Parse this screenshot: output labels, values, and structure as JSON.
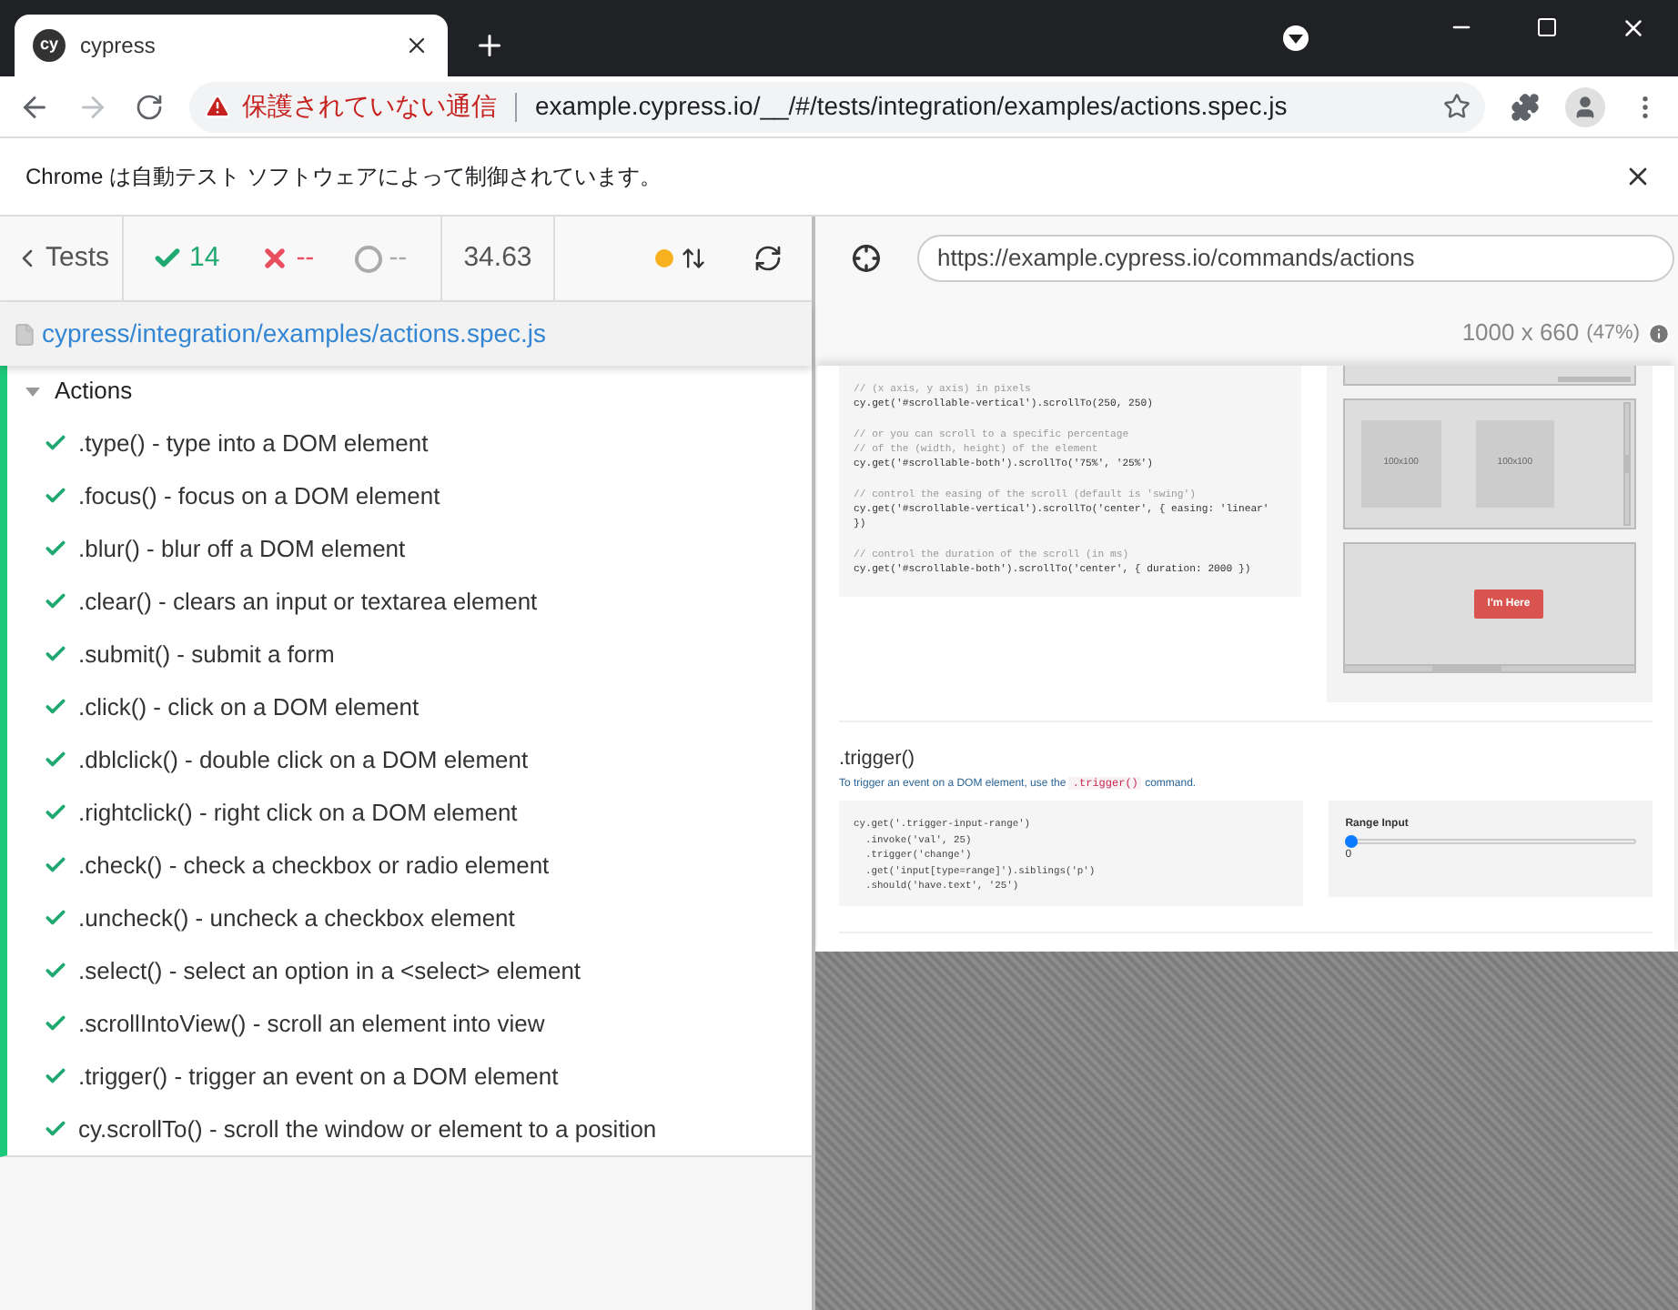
{
  "browser": {
    "tab": {
      "logo": "cy",
      "title": "cypress"
    },
    "security_warning": "保護されていない通信",
    "url": "example.cypress.io/__/#/tests/integration/examples/actions.spec.js",
    "infobar": "Chrome は自動テスト ソフトウェアによって制御されています。"
  },
  "reporter": {
    "back": "Tests",
    "passed": "14",
    "failed": "--",
    "pending": "--",
    "duration": "34.63",
    "spec_path": "cypress/integration/examples/actions.spec.js",
    "suite": {
      "title": "Actions",
      "expanded": true,
      "tests": [
        {
          "title": ".type() - type into a DOM element",
          "passed": true
        },
        {
          "title": ".focus() - focus on a DOM element",
          "passed": true
        },
        {
          "title": ".blur() - blur off a DOM element",
          "passed": true
        },
        {
          "title": ".clear() - clears an input or textarea element",
          "passed": true
        },
        {
          "title": ".submit() - submit a form",
          "passed": true
        },
        {
          "title": ".click() - click on a DOM element",
          "passed": true
        },
        {
          "title": ".dblclick() - double click on a DOM element",
          "passed": true
        },
        {
          "title": ".rightclick() - right click on a DOM element",
          "passed": true
        },
        {
          "title": ".check() - check a checkbox or radio element",
          "passed": true
        },
        {
          "title": ".uncheck() - uncheck a checkbox element",
          "passed": true
        },
        {
          "title": ".select() - select an option in a <select> element",
          "passed": true
        },
        {
          "title": ".scrollIntoView() - scroll an element into view",
          "passed": true
        },
        {
          "title": ".trigger() - trigger an event on a DOM element",
          "passed": true
        },
        {
          "title": "cy.scrollTo() - scroll the window or element to a position",
          "passed": true
        }
      ]
    }
  },
  "aut": {
    "url": "https://example.cypress.io/commands/actions",
    "viewport": "1000 x 660",
    "scale": "(47%)",
    "page": {
      "code_block": [
        [
          {
            "kind": "comment",
            "text": "// (x axis, y axis) in pixels"
          },
          {
            "kind": "code",
            "text": "cy.get('#scrollable-vertical').scrollTo(250, 250)"
          }
        ],
        [
          {
            "kind": "comment",
            "text": "// or you can scroll to a specific percentage"
          },
          {
            "kind": "comment",
            "text": "// of the (width, height) of the element"
          },
          {
            "kind": "code",
            "text": "cy.get('#scrollable-both').scrollTo('75%', '25%')"
          }
        ],
        [
          {
            "kind": "comment",
            "text": "// control the easing of the scroll (default is 'swing')"
          },
          {
            "kind": "code",
            "text": "cy.get('#scrollable-vertical').scrollTo('center', { easing: 'linear' })"
          }
        ],
        [
          {
            "kind": "comment",
            "text": "// control the duration of the scroll (in ms)"
          },
          {
            "kind": "code",
            "text": "cy.get('#scrollable-both').scrollTo('center', { duration: 2000 })"
          }
        ]
      ],
      "squares": [
        "100x100",
        "100x100"
      ],
      "button": "I'm Here",
      "section_title": ".trigger()",
      "description": {
        "before": "To trigger an event on a DOM element, use the ",
        "code": ".trigger()",
        "after": " command."
      },
      "code_block_2": [
        "cy.get('.trigger-input-range')",
        "  .invoke('val', 25)",
        "  .trigger('change')",
        "  .get('input[type=range]').siblings('p')",
        "  .should('have.text', '25')"
      ],
      "range": {
        "label": "Range Input",
        "level": 0,
        "value": "0"
      }
    }
  }
}
